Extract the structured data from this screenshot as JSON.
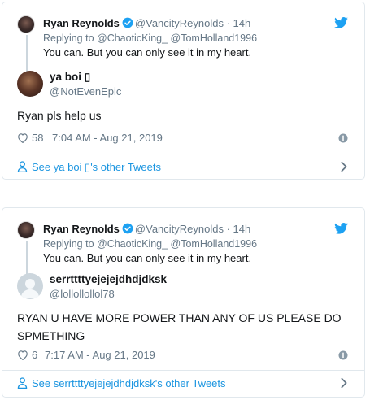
{
  "tweets": [
    {
      "quoted": {
        "name": "Ryan Reynolds",
        "handle": "@VancityReynolds",
        "time": "· 14h",
        "replying": "Replying to @ChaoticKing_ @TomHolland1996",
        "text": "You can. But you can only see it in my heart."
      },
      "author": {
        "name": "ya boi ▯",
        "handle": "@NotEvenEpic"
      },
      "text": "Ryan pls help us",
      "likes": "58",
      "timestamp": "7:04 AM - Aug 21, 2019",
      "footer_link": "See ya boi ▯'s other Tweets"
    },
    {
      "quoted": {
        "name": "Ryan Reynolds",
        "handle": "@VancityReynolds",
        "time": "· 14h",
        "replying": "Replying to @ChaoticKing_ @TomHolland1996",
        "text": "You can. But you can only see it in my heart."
      },
      "author": {
        "name": "serrttttyejejejdhdjdksk",
        "handle": "@lollollollol78"
      },
      "text": "RYAN U HAVE MORE POWER THAN ANY OF US PLEASE DO SPMETHING",
      "likes": "6",
      "timestamp": "7:17 AM - Aug 21, 2019",
      "footer_link": "See serrttttyejejejdhdjdksk's other Tweets"
    }
  ],
  "colors": {
    "twitter_blue": "#1da1f2",
    "link_blue": "#1b95e0",
    "muted": "#657786",
    "border": "#e1e8ed"
  }
}
